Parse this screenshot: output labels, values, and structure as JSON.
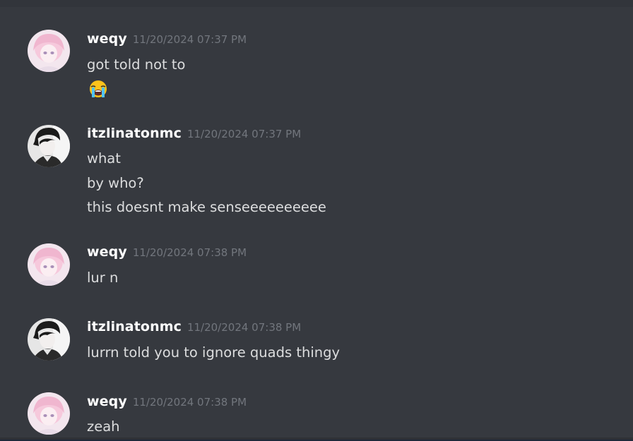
{
  "messages": [
    {
      "author": "weqy",
      "avatar": "pink-anime-avatar",
      "timestamp": "11/20/2024 07:37 PM",
      "lines": [
        "got told not to"
      ],
      "emoji": "loudly-crying-face-emoji"
    },
    {
      "author": "itzlinatonmc",
      "avatar": "monochrome-anime-avatar",
      "timestamp": "11/20/2024 07:37 PM",
      "lines": [
        "what",
        "by who?",
        "this doesnt make senseeeeeeeeee"
      ]
    },
    {
      "author": "weqy",
      "avatar": "pink-anime-avatar",
      "timestamp": "11/20/2024 07:38 PM",
      "lines": [
        "lur n"
      ]
    },
    {
      "author": "itzlinatonmc",
      "avatar": "monochrome-anime-avatar",
      "timestamp": "11/20/2024 07:38 PM",
      "lines": [
        "lurrn told you to ignore quads thingy"
      ]
    },
    {
      "author": "weqy",
      "avatar": "pink-anime-avatar",
      "timestamp": "11/20/2024 07:38 PM",
      "lines": [
        "zeah"
      ]
    }
  ],
  "colors": {
    "background": "#36393f",
    "username": "#ffffff",
    "timestamp": "#72767d",
    "message_text": "#dcddde"
  }
}
